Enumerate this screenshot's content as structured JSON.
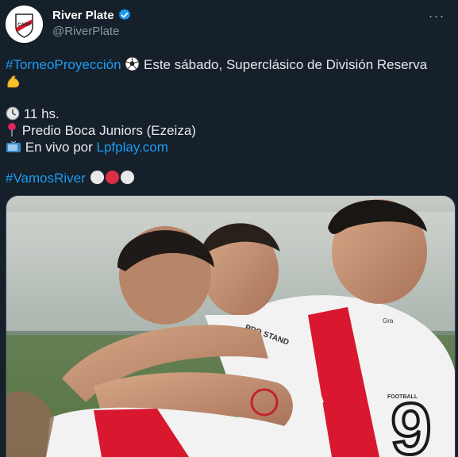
{
  "author": {
    "display_name": "River Plate",
    "handle": "@RiverPlate",
    "verified_icon": "verified-badge-icon",
    "avatar_icon": "river-plate-crest",
    "avatar_text": "CARP"
  },
  "menu": {
    "more_label": "···"
  },
  "tweet": {
    "hashtag_1": "#TorneoProyección",
    "line_1_text": " Este sábado, Superclásico de División Reserva",
    "time_text": "11 hs.",
    "place_text": "Predio Boca Juniors (Ezeiza)",
    "live_prefix": "En vivo por ",
    "live_link": "Lpfplay.com",
    "hashtag_2": "#VamosRiver",
    "emoji_icons": [
      "soccer-ball-icon",
      "flexed-biceps-icon",
      "clock-icon",
      "round-pushpin-icon",
      "television-icon",
      "white-circle-icon",
      "red-circle-icon",
      "white-circle-icon"
    ]
  },
  "media": {
    "description_icon": "celebrating-players-photo",
    "shirt_number": "9",
    "chest_text": "PRO STAND",
    "sponsor_text": "Gra",
    "collar_text": "FOOTBALL",
    "colors": {
      "red": "#d9172f",
      "white": "#f2f2f2",
      "accent": "#1d9bf0"
    }
  }
}
